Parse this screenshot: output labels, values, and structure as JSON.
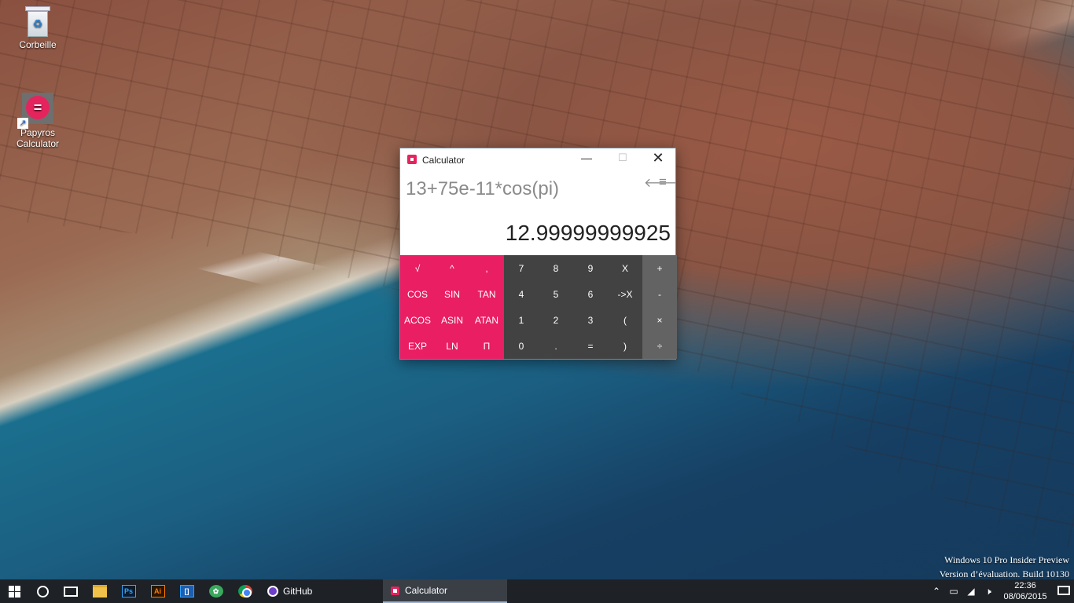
{
  "desktop": {
    "icons": [
      {
        "label": "Corbeille"
      },
      {
        "label": "Papyros Calculator"
      }
    ],
    "watermark": {
      "line1": "Windows 10 Pro Insider Preview",
      "line2": "Version d’évaluation. Build 10130"
    }
  },
  "calculator": {
    "title": "Calculator",
    "controls": {
      "minimize": "—",
      "maximize": "☐",
      "close": "✕"
    },
    "expression": "13+75e-11*cos(pi)",
    "result": "12.99999999925",
    "function_keys": [
      "√",
      "^",
      ",",
      "COS",
      "SIN",
      "TAN",
      "ACOS",
      "ASIN",
      "ATAN",
      "EXP",
      "LN",
      "Π"
    ],
    "number_keys": [
      "7",
      "8",
      "9",
      "X",
      "4",
      "5",
      "6",
      "->X",
      "1",
      "2",
      "3",
      "(",
      "0",
      ".",
      "=",
      ")"
    ],
    "operator_keys": [
      "+",
      "-",
      "×",
      "÷"
    ],
    "accent_color": "#e91e63",
    "number_pad_color": "#424242",
    "operator_pad_color": "#636363"
  },
  "taskbar": {
    "pinned_icons": [
      "file-explorer-icon",
      "photoshop-icon",
      "illustrator-icon",
      "brackets-icon",
      "gear-app-icon",
      "chrome-icon"
    ],
    "ps_label": "Ps",
    "ai_label": "Ai",
    "brackets_label": "[]",
    "tasks": [
      {
        "label": "GitHub"
      },
      {
        "label": "Calculator"
      }
    ],
    "clock": {
      "time": "22:36",
      "date": "08/06/2015"
    }
  }
}
